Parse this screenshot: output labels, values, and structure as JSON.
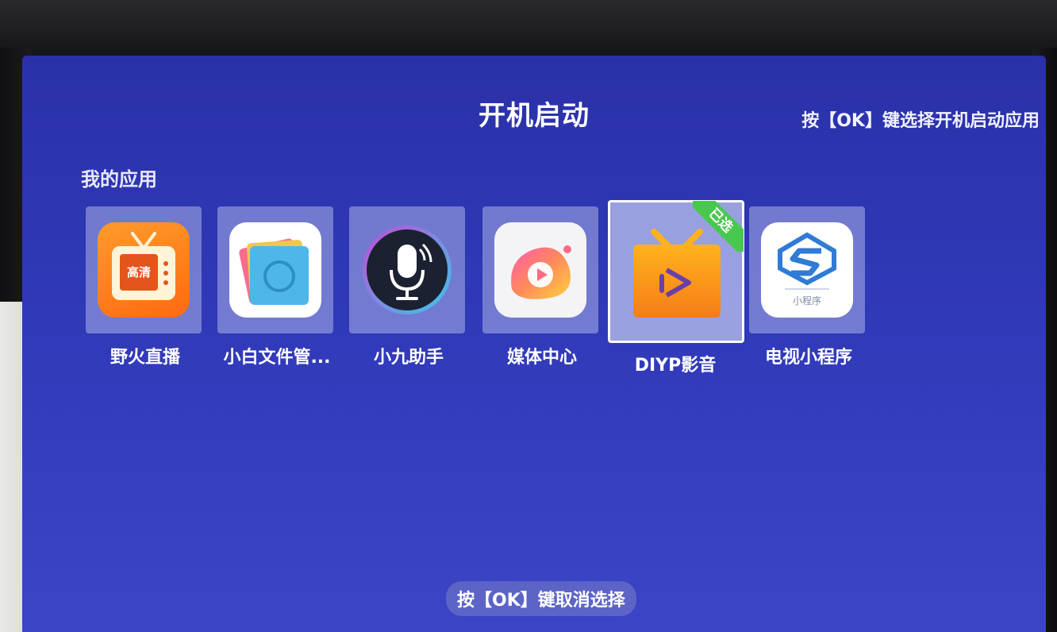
{
  "header": {
    "title": "开机启动",
    "hint": "按【OK】键选择开机启动应用"
  },
  "section": {
    "label": "我的应用"
  },
  "apps": [
    {
      "label": "野火直播",
      "icon": "tv-hd-icon",
      "icon_text": "高清",
      "selected": false
    },
    {
      "label": "小白文件管...",
      "icon": "file-manager-icon",
      "selected": false
    },
    {
      "label": "小九助手",
      "icon": "microphone-icon",
      "selected": false
    },
    {
      "label": "媒体中心",
      "icon": "media-center-icon",
      "selected": false
    },
    {
      "label": "DIYP影音",
      "icon": "tv-play-icon",
      "selected": true,
      "badge": "已选"
    },
    {
      "label": "电视小程序",
      "icon": "mini-program-icon",
      "icon_text": "小程序",
      "selected": false
    }
  ],
  "footer": {
    "hint": "按【OK】键取消选择"
  },
  "colors": {
    "screen_bg": "#3039b8",
    "badge": "#49c84f",
    "text": "#ffffff"
  }
}
